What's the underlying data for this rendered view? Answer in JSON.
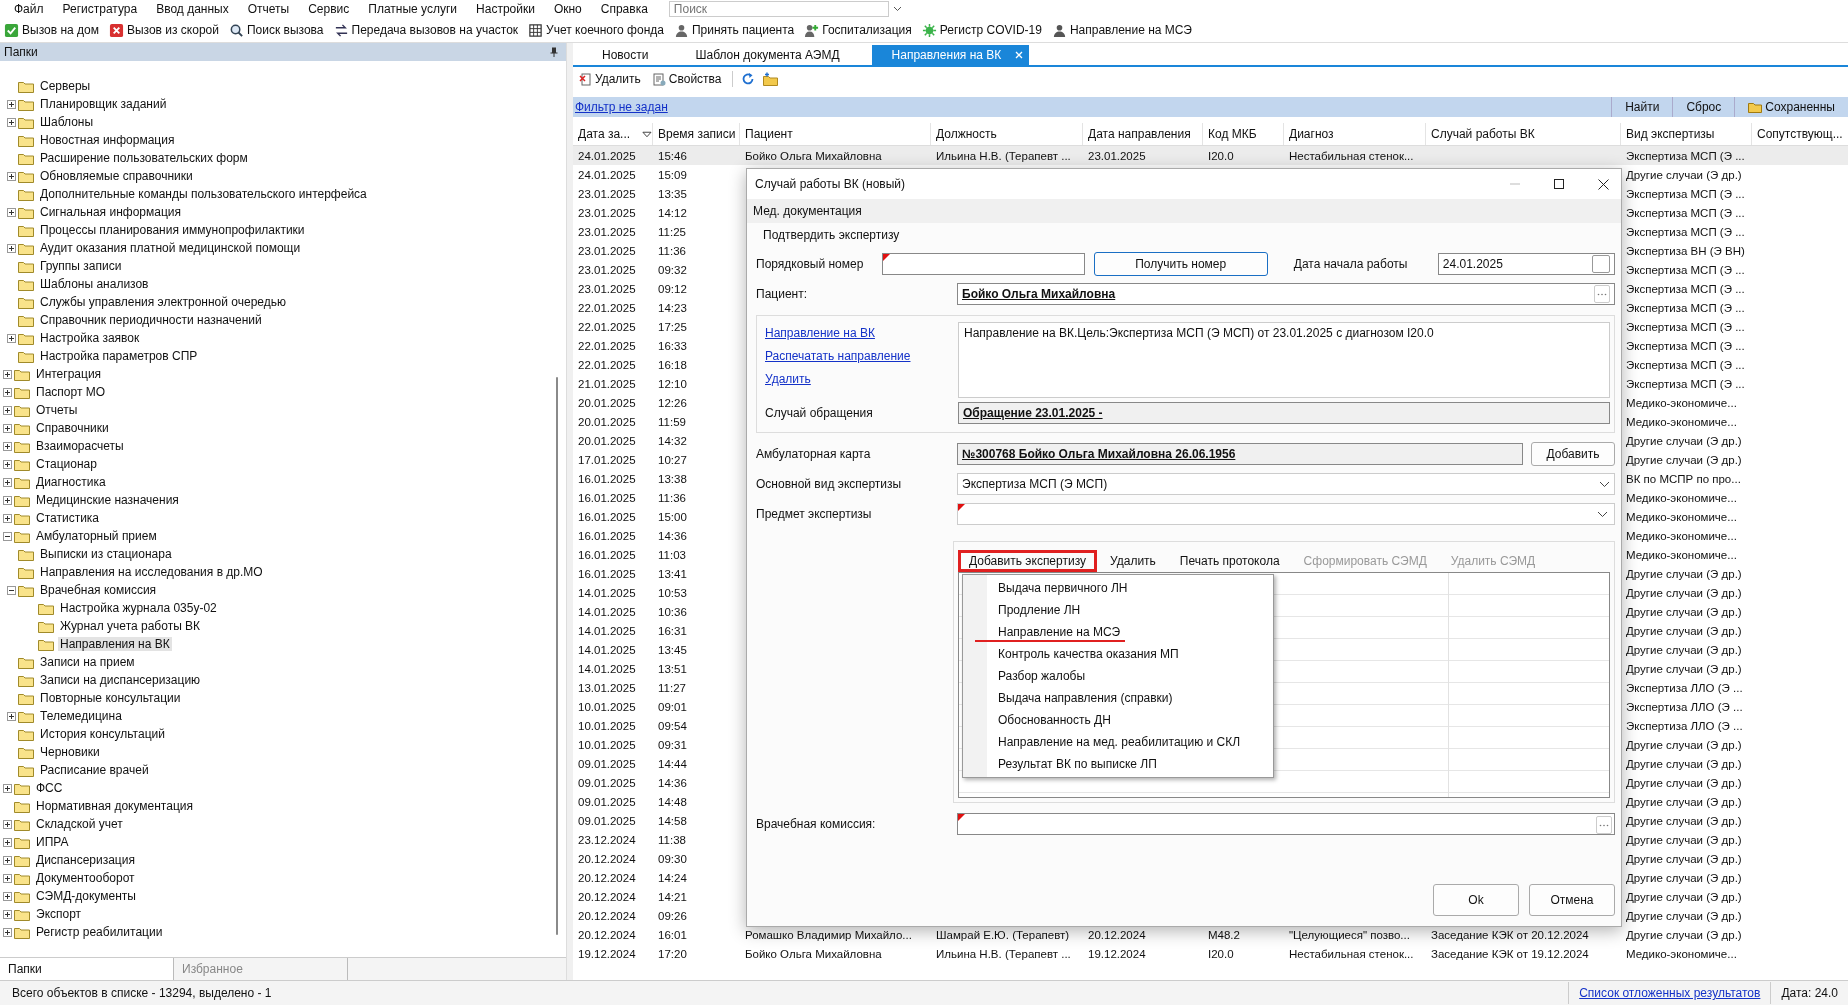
{
  "menu_bar": {
    "items": [
      "Файл",
      "Регистратура",
      "Ввод данных",
      "Отчеты",
      "Сервис",
      "Платные услуги",
      "Настройки",
      "Окно",
      "Справка"
    ],
    "search": {
      "placeholder": "Поиск"
    }
  },
  "toolbar": [
    "Вызов на дом",
    "Вызов из скорой",
    "Поиск вызова",
    "Передача вызовов на участок",
    "Учет коечного фонда",
    "Принять пациента",
    "Госпитализация",
    "Регистр COVID-19",
    "Направление на МСЭ"
  ],
  "folders_panel": {
    "title": "Папки",
    "tree": [
      {
        "children": [
          {
            "label": "Серверы",
            "selected": false
          },
          {
            "label": "Планировщик заданий",
            "expanded": false,
            "selected": false
          },
          {
            "label": "Шаблоны",
            "expanded": false,
            "selected": false
          },
          {
            "label": "Новостная информация",
            "selected": false
          },
          {
            "label": "Расширение пользовательских форм",
            "selected": false
          },
          {
            "label": "Обновляемые справочники",
            "expanded": false,
            "selected": false
          },
          {
            "label": "Дополнительные команды пользовательского интерфейса",
            "selected": false
          },
          {
            "label": "Сигнальная информация",
            "expanded": false,
            "selected": false
          },
          {
            "label": "Процессы планирования иммунопрофилактики",
            "selected": false
          },
          {
            "label": "Аудит оказания платной медицинской помощи",
            "expanded": false,
            "selected": false
          },
          {
            "label": "Группы записи",
            "selected": false
          },
          {
            "label": "Шаблоны анализов",
            "selected": false
          },
          {
            "label": "Службы управления электронной очередью",
            "selected": false
          },
          {
            "label": "Справочник периодичности назначений",
            "selected": false
          },
          {
            "label": "Настройка заявок",
            "expanded": false,
            "selected": false
          },
          {
            "label": "Настройка параметров СПР",
            "selected": false
          }
        ]
      },
      {
        "label": "Интеграция",
        "expanded": false,
        "selected": false
      },
      {
        "label": "Паспорт МО",
        "expanded": false,
        "selected": false
      },
      {
        "label": "Отчеты",
        "expanded": false,
        "selected": false
      },
      {
        "label": "Справочники",
        "expanded": false,
        "selected": false
      },
      {
        "label": "Взаиморасчеты",
        "expanded": false,
        "selected": false
      },
      {
        "label": "Стационар",
        "expanded": false,
        "selected": false
      },
      {
        "label": "Диагностика",
        "expanded": false,
        "selected": false
      },
      {
        "label": "Медицинские назначения",
        "expanded": false,
        "selected": false
      },
      {
        "label": "Статистика",
        "expanded": false,
        "selected": false
      },
      {
        "label": "Амбулаторный прием",
        "expanded": true,
        "selected": false,
        "children": [
          {
            "label": "Выписки из стационара",
            "selected": false
          },
          {
            "label": "Направления на исследования в др.МО",
            "selected": false
          },
          {
            "label": "Врачебная комиссия",
            "expanded": true,
            "selected": false,
            "children": [
              {
                "label": "Настройка журнала 035у-02",
                "selected": false
              },
              {
                "label": "Журнал учета работы ВК",
                "selected": false
              },
              {
                "label": "Направления на ВК",
                "selected": true
              }
            ]
          },
          {
            "label": "Записи на прием",
            "selected": false
          },
          {
            "label": "Записи на диспансеризацию",
            "selected": false
          },
          {
            "label": "Повторные консультации",
            "selected": false
          },
          {
            "label": "Телемедицина",
            "expanded": false,
            "selected": false
          },
          {
            "label": "История консультаций",
            "selected": false
          },
          {
            "label": "Черновики",
            "selected": false
          },
          {
            "label": "Расписание врачей",
            "selected": false
          }
        ]
      },
      {
        "label": "ФСС",
        "expanded": false,
        "selected": false
      },
      {
        "label": "Нормативная документация",
        "selected": false
      },
      {
        "label": "Складской учет",
        "expanded": false,
        "selected": false
      },
      {
        "label": "ИПРА",
        "expanded": false,
        "selected": false
      },
      {
        "label": "Диспансеризация",
        "expanded": false,
        "selected": false
      },
      {
        "label": "Документооборот",
        "expanded": false,
        "selected": false
      },
      {
        "label": "СЭМД-документы",
        "expanded": false,
        "selected": false
      },
      {
        "label": "Экспорт",
        "expanded": false,
        "selected": false
      },
      {
        "label": "Регистр реабилитации",
        "expanded": false,
        "selected": false
      }
    ],
    "tabs": [
      {
        "label": "Папки",
        "selected": true
      },
      {
        "label": "Избранное",
        "selected": false
      }
    ]
  },
  "document_tabs": [
    {
      "label": "Новости",
      "selected": false,
      "closable": false
    },
    {
      "label": "Шаблон документа АЭМД",
      "selected": false,
      "closable": false
    },
    {
      "label": "Направления на ВК",
      "selected": true,
      "closable": true
    }
  ],
  "list_toolbar": [
    "Удалить",
    "Свойства"
  ],
  "filter_bar": {
    "filter": "Фильтр не задан",
    "buttons": [
      "Найти",
      "Сброс",
      "Сохраненны"
    ]
  },
  "table": {
    "columns": [
      "Дата за...",
      "Время записи",
      "Пациент",
      "Должность",
      "Дата направления",
      "Код МКБ",
      "Диагноз",
      "Случай работы ВК",
      "Вид экспертизы",
      "Сопутствующ..."
    ],
    "rows": [
      {
        "date": "24.01.2025",
        "time": "15:46",
        "patient": "Бойко Ольга Михайловна",
        "position": "Ильина Н.В. (Терапевт ...",
        "referral_date": "23.01.2025",
        "icd": "I20.0",
        "diagnosis": "Нестабильная стенок...",
        "type": "Экспертиза МСП (Э ...",
        "selected": true
      },
      {
        "date": "24.01.2025",
        "time": "15:09",
        "type": "Другие случаи (Э др.)",
        "selected": false
      },
      {
        "date": "23.01.2025",
        "time": "13:35",
        "type": "Экспертиза МСП (Э ...",
        "selected": false
      },
      {
        "date": "23.01.2025",
        "time": "14:12",
        "type": "Экспертиза МСП (Э ...",
        "selected": false
      },
      {
        "date": "23.01.2025",
        "time": "11:25",
        "type": "Экспертиза МСП (Э ...",
        "selected": false
      },
      {
        "date": "23.01.2025",
        "time": "11:36",
        "type": "Экспертиза ВН (Э ВН)",
        "selected": false
      },
      {
        "date": "23.01.2025",
        "time": "09:32",
        "type": "Экспертиза МСП (Э ...",
        "selected": false
      },
      {
        "date": "23.01.2025",
        "time": "09:12",
        "type": "Экспертиза МСП (Э ...",
        "selected": false
      },
      {
        "date": "22.01.2025",
        "time": "14:23",
        "type": "Экспертиза МСП (Э ...",
        "selected": false
      },
      {
        "date": "22.01.2025",
        "time": "17:25",
        "type": "Экспертиза МСП (Э ...",
        "selected": false
      },
      {
        "date": "22.01.2025",
        "time": "16:33",
        "type": "Экспертиза МСП (Э ...",
        "selected": false
      },
      {
        "date": "22.01.2025",
        "time": "16:18",
        "type": "Экспертиза МСП (Э ...",
        "selected": false
      },
      {
        "date": "21.01.2025",
        "time": "12:10",
        "type": "Экспертиза МСП (Э ...",
        "selected": false
      },
      {
        "date": "20.01.2025",
        "time": "12:26",
        "type": "Медико-экономиче...",
        "selected": false
      },
      {
        "date": "20.01.2025",
        "time": "11:59",
        "type": "Медико-экономиче...",
        "selected": false
      },
      {
        "date": "20.01.2025",
        "time": "14:32",
        "type": "Другие случаи (Э др.)",
        "selected": false
      },
      {
        "date": "17.01.2025",
        "time": "10:27",
        "type": "Другие случаи (Э др.)",
        "selected": false
      },
      {
        "date": "16.01.2025",
        "time": "13:38",
        "type": "ВК по МСПР по про...",
        "selected": false
      },
      {
        "date": "16.01.2025",
        "time": "11:36",
        "type": "Медико-экономиче...",
        "selected": false
      },
      {
        "date": "16.01.2025",
        "time": "15:00",
        "type": "Медико-экономиче...",
        "selected": false
      },
      {
        "date": "16.01.2025",
        "time": "14:36",
        "type": "Медико-экономиче...",
        "selected": false
      },
      {
        "date": "16.01.2025",
        "time": "11:03",
        "type": "Медико-экономиче...",
        "selected": false
      },
      {
        "date": "16.01.2025",
        "time": "13:41",
        "type": "Другие случаи (Э др.)",
        "selected": false
      },
      {
        "date": "14.01.2025",
        "time": "10:53",
        "type": "Другие случаи (Э др.)",
        "selected": false
      },
      {
        "date": "14.01.2025",
        "time": "10:36",
        "type": "Другие случаи (Э др.)",
        "selected": false
      },
      {
        "date": "14.01.2025",
        "time": "16:31",
        "type": "Другие случаи (Э др.)",
        "selected": false
      },
      {
        "date": "14.01.2025",
        "time": "13:45",
        "type": "Другие случаи (Э др.)",
        "selected": false
      },
      {
        "date": "14.01.2025",
        "time": "13:51",
        "type": "Другие случаи (Э др.)",
        "selected": false
      },
      {
        "date": "13.01.2025",
        "time": "11:27",
        "type": "Экспертиза ЛЛО (Э ...",
        "selected": false
      },
      {
        "date": "10.01.2025",
        "time": "09:01",
        "type": "Экспертиза ЛЛО (Э ...",
        "selected": false
      },
      {
        "date": "10.01.2025",
        "time": "09:54",
        "type": "Экспертиза ЛЛО (Э ...",
        "selected": false
      },
      {
        "date": "10.01.2025",
        "time": "09:31",
        "type": "Другие случаи (Э др.)",
        "selected": false
      },
      {
        "date": "09.01.2025",
        "time": "14:44",
        "type": "Другие случаи (Э др.)",
        "selected": false
      },
      {
        "date": "09.01.2025",
        "time": "14:36",
        "type": "Другие случаи (Э др.)",
        "selected": false
      },
      {
        "date": "09.01.2025",
        "time": "14:48",
        "type": "Другие случаи (Э др.)",
        "selected": false
      },
      {
        "date": "09.01.2025",
        "time": "14:58",
        "type": "Другие случаи (Э др.)",
        "selected": false
      },
      {
        "date": "23.12.2024",
        "time": "11:38",
        "type": "Другие случаи (Э др.)",
        "selected": false
      },
      {
        "date": "20.12.2024",
        "time": "09:30",
        "type": "Другие случаи (Э др.)",
        "selected": false
      },
      {
        "date": "20.12.2024",
        "time": "14:24",
        "type": "Другие случаи (Э др.)",
        "selected": false
      },
      {
        "date": "20.12.2024",
        "time": "14:21",
        "type": "Другие случаи (Э др.)",
        "selected": false
      },
      {
        "date": "20.12.2024",
        "time": "09:26",
        "type": "Другие случаи (Э др.)",
        "selected": false
      },
      {
        "date": "20.12.2024",
        "time": "16:01",
        "patient": "Ромашко Владимир Михайло...",
        "position": "Шамрай Е.Ю. (Терапевт)",
        "referral_date": "20.12.2024",
        "icd": "M48.2",
        "diagnosis": "\"Целующиеся\" позво...",
        "case": "Заседание КЭК от 20.12.2024",
        "type": "Другие случаи (Э др.)",
        "selected": false
      },
      {
        "date": "19.12.2024",
        "time": "17:20",
        "patient": "Бойко Ольга Михайловна",
        "position": "Ильина Н.В. (Терапевт ...",
        "referral_date": "19.12.2024",
        "icd": "I20.0",
        "diagnosis": "Нестабильная стенок...",
        "case": "Заседание КЭК от 19.12.2024",
        "type": "Медико-экономиче...",
        "selected": false
      }
    ]
  },
  "dialog": {
    "title": "Случай работы ВК (новый)",
    "menu": [
      "Мед. документация"
    ],
    "toolbar": [
      "Подтвердить экспертизу"
    ],
    "number": {
      "label": "Порядковый номер",
      "required": true
    },
    "get_number_button": "Получить номер",
    "start_date": {
      "label": "Дата начала работы",
      "value": "24.01.2025",
      "checked": false
    },
    "patient": {
      "label": "Пациент:",
      "value": "Бойко Ольга Михайловна"
    },
    "referral": {
      "links": [
        "Направление на ВК",
        "Распечатать направление",
        "Удалить"
      ],
      "text": "Направление на ВК.Цель:Экспертиза МСП (Э МСП) от 23.01.2025 с диагнозом I20.0",
      "case_label": "Случай обращения",
      "case_value": "Обращение 23.01.2025 -"
    },
    "card": {
      "label": "Амбулаторная карта",
      "value": "№300768 Бойко Ольга Михайловна 26.06.1956",
      "button": "Добавить"
    },
    "main_type": {
      "label": "Основной вид экспертизы",
      "value": "Экспертиза МСП (Э МСП)"
    },
    "subject": {
      "label": "Предмет экспертизы",
      "required": true
    },
    "expertise_toolbar": [
      {
        "label": "Добавить экспертизу",
        "disabled": false,
        "highlighted": true
      },
      {
        "label": "Удалить",
        "disabled": false,
        "highlighted": false
      },
      {
        "label": "Печать протокола",
        "disabled": false,
        "highlighted": false
      },
      {
        "label": "Сформировать СЭМД",
        "disabled": true,
        "highlighted": false
      },
      {
        "label": "Удалить СЭМД",
        "disabled": true,
        "highlighted": false
      }
    ],
    "add_menu": [
      {
        "label": "Выдача первичного ЛН",
        "underlined": false
      },
      {
        "label": "Продление ЛН",
        "underlined": false
      },
      {
        "label": "Направление на МСЭ",
        "underlined": true
      },
      {
        "label": "Контроль качества оказания МП",
        "underlined": false
      },
      {
        "label": "Разбор жалобы",
        "underlined": false
      },
      {
        "label": "Выдача направления (справки)",
        "underlined": false
      },
      {
        "label": "Обоснованность ДН",
        "underlined": false
      },
      {
        "label": "Направление на мед. реабилитацию и СКЛ",
        "underlined": false
      },
      {
        "label": "Результат ВК по выписке ЛП",
        "underlined": false
      }
    ],
    "commission": {
      "label": "Врачебная комиссия:",
      "required": true
    },
    "buttons": [
      "Ok",
      "Отмена"
    ]
  },
  "status_bar": {
    "text": "Всего объектов в списке - 13294, выделено - 1",
    "link": "Список отложенных результатов",
    "date": "Дата: 24.0"
  }
}
